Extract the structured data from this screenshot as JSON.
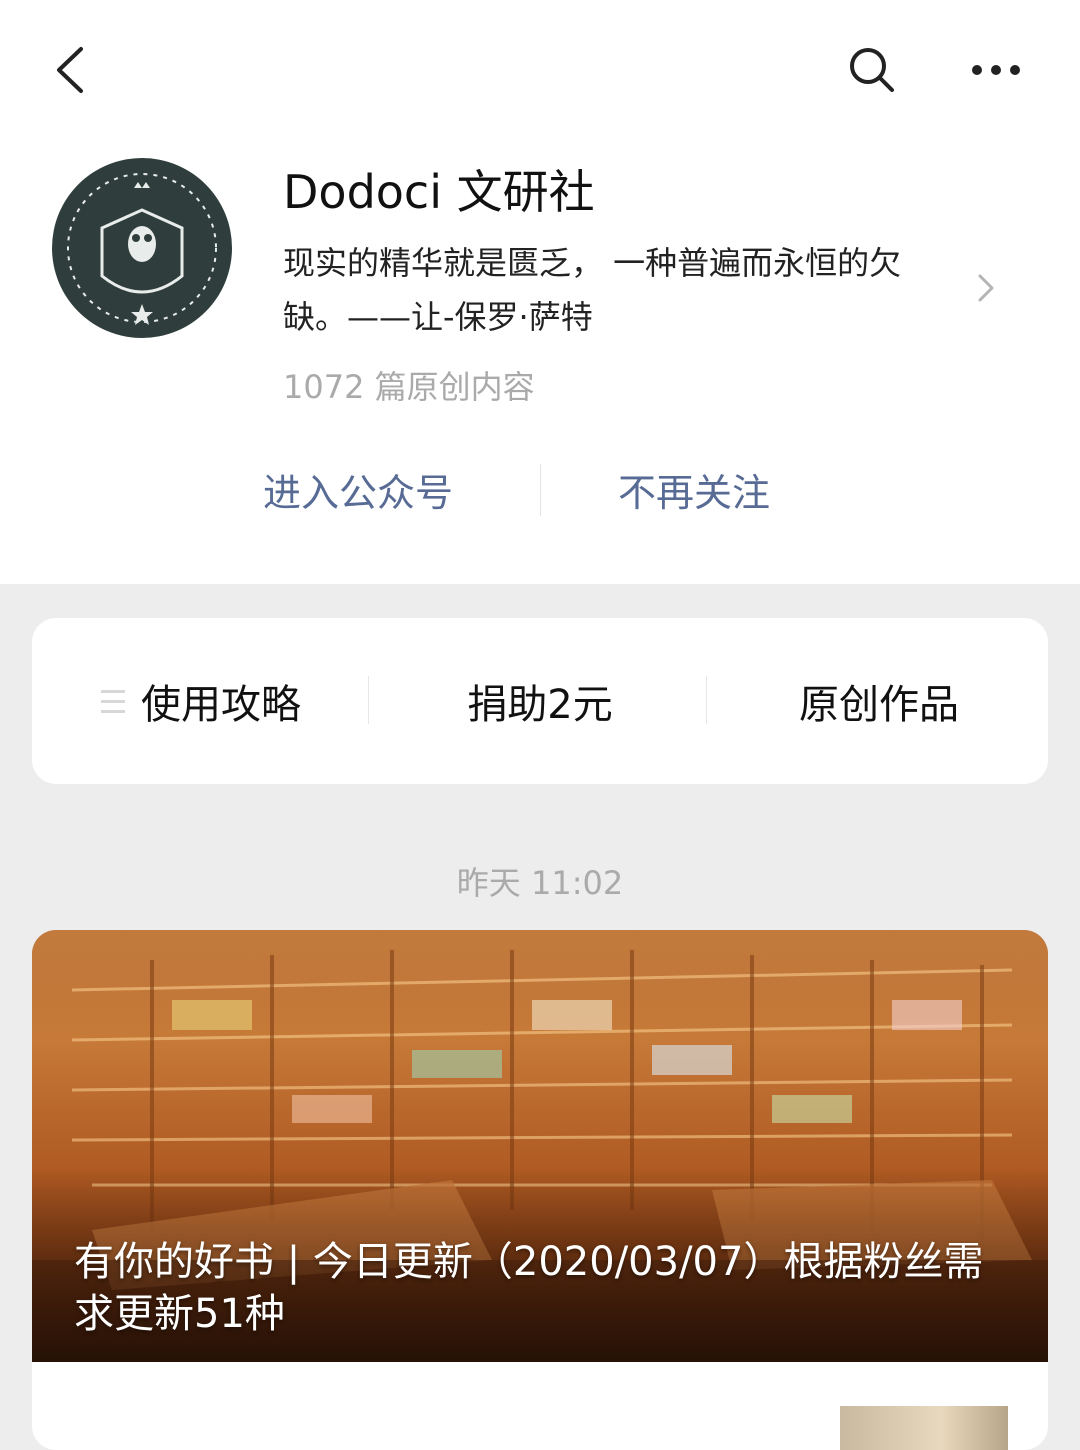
{
  "nav": {
    "back_icon": "chevron-left-icon",
    "search_icon": "search-icon",
    "more_icon": "more-dots-icon"
  },
  "profile": {
    "name": "Dodoci 文研社",
    "avatar_text": "Dodoci 文研社",
    "description": "现实的精华就是匮乏， 一种普遍而永恒的欠缺。——让-保罗·萨特",
    "article_count": "1072 篇原创内容"
  },
  "actions": {
    "enter": "进入公众号",
    "unfollow": "不再关注"
  },
  "menu": [
    {
      "label": "使用攻略"
    },
    {
      "label": "捐助2元"
    },
    {
      "label": "原创作品"
    }
  ],
  "feed": {
    "timestamp": "昨天 11:02",
    "article": {
      "title": "有你的好书 | 今日更新（2020/03/07）根据粉丝需求更新51种"
    }
  },
  "colors": {
    "link": "#576b95",
    "background": "#ededed",
    "card": "#ffffff",
    "muted": "#aaaaaa"
  }
}
